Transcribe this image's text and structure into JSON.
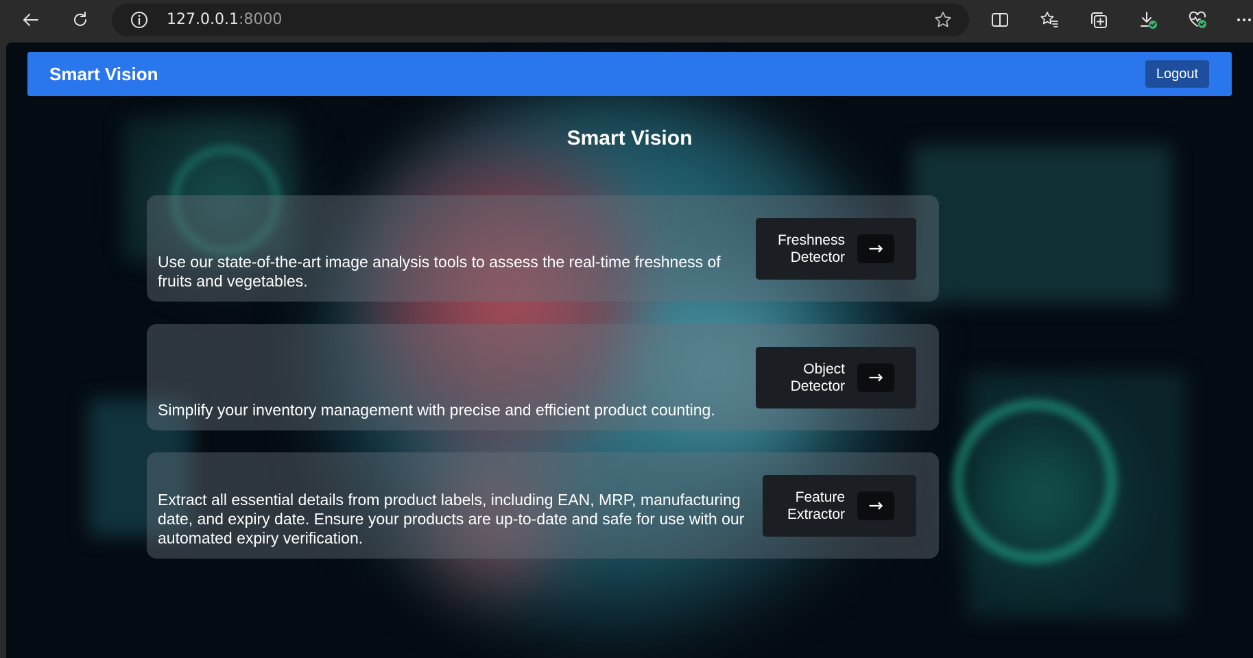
{
  "browser": {
    "url_host": "127.0.0.1",
    "url_port": ":8000",
    "icons": [
      "back-icon",
      "refresh-icon",
      "site-info-icon",
      "favorite-star-icon",
      "split-screen-icon",
      "favorites-icon",
      "collections-icon",
      "downloads-icon",
      "browser-essentials-icon",
      "more-icon"
    ]
  },
  "navbar": {
    "brand": "Smart Vision",
    "logout_label": "Logout",
    "color": "#2a76ec"
  },
  "main": {
    "title": "Smart Vision",
    "cards": [
      {
        "description": "Use our state-of-the-art image analysis tools to assess the real-time freshness of fruits and vegetables.",
        "button_label": "Freshness Detector",
        "arrow": "→"
      },
      {
        "description": "Simplify your inventory management with precise and efficient product counting.",
        "button_label": "Object Detector",
        "arrow": "→"
      },
      {
        "description": "Extract all essential details from product labels, including EAN, MRP, manufacturing date, and expiry date. Ensure your products are up-to-date and safe for use with our automated expiry verification.",
        "button_label": "Feature Extractor",
        "arrow": "→"
      }
    ]
  }
}
